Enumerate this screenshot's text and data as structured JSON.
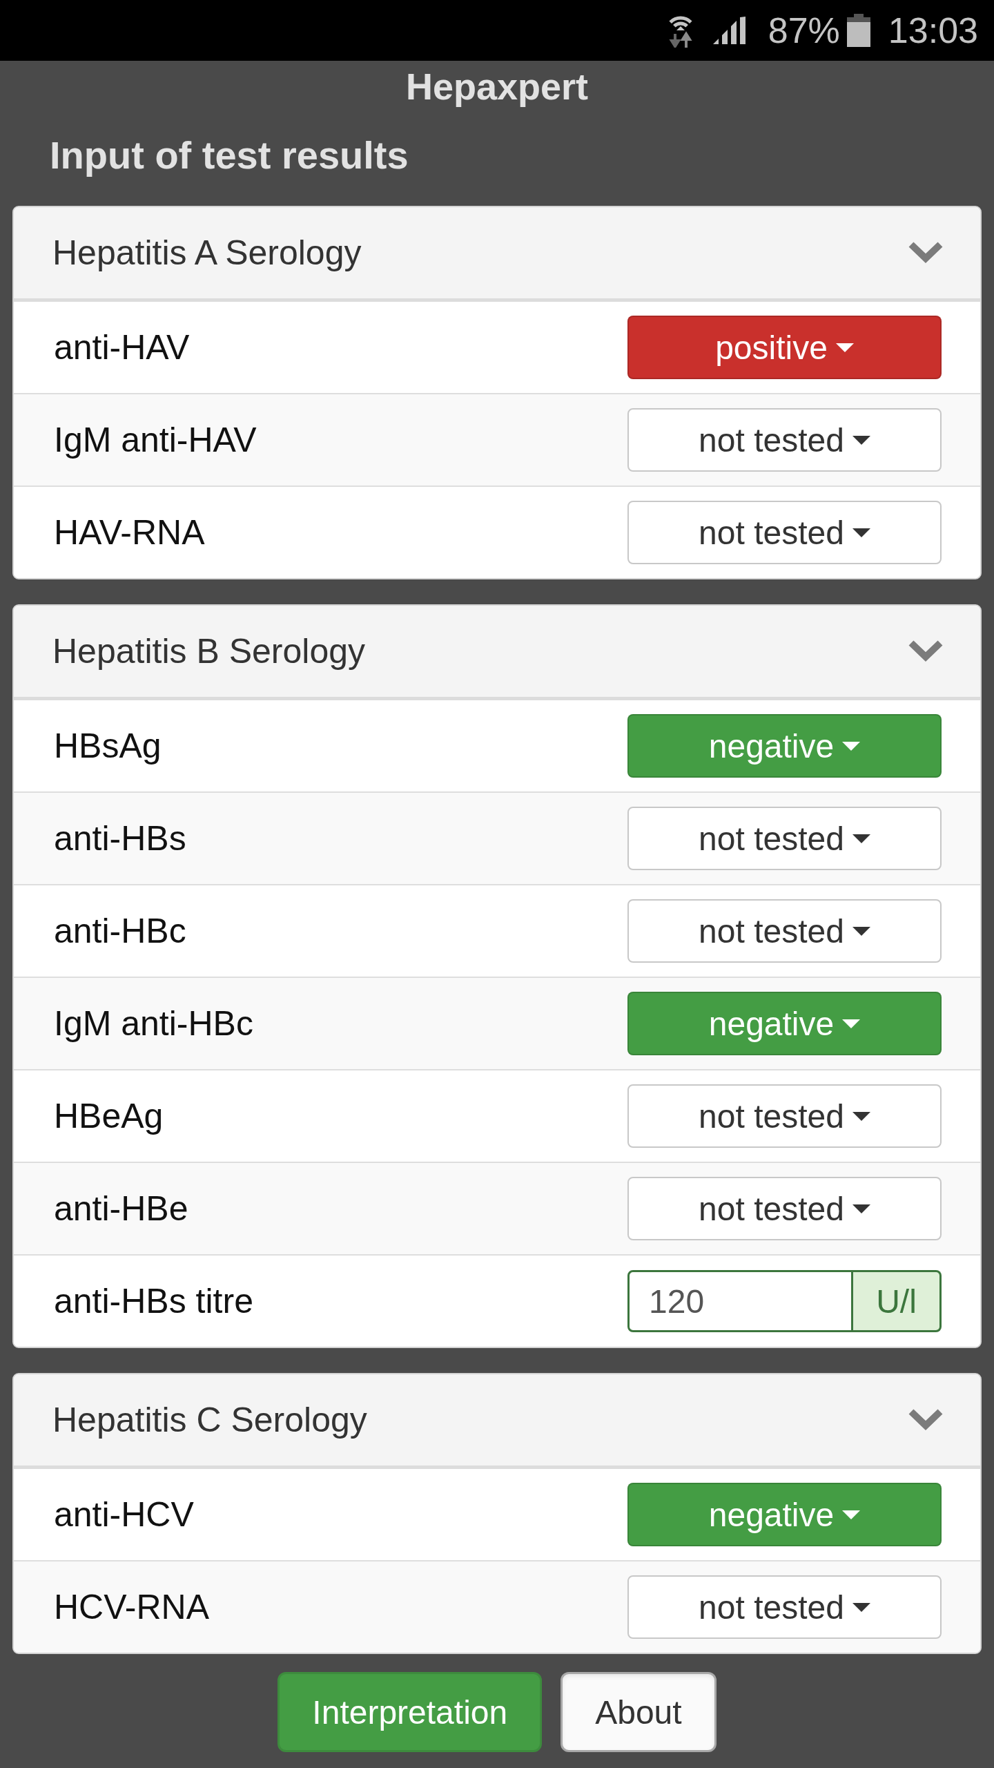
{
  "status_bar": {
    "battery": "87%",
    "time": "13:03"
  },
  "app_title": "Hepaxpert",
  "heading": "Input of test results",
  "panels": [
    {
      "title": "Hepatitis A Serology",
      "expanded": true,
      "rows": [
        {
          "kind": "select",
          "label": "anti-HAV",
          "value": "positive",
          "color": "#c9302c"
        },
        {
          "kind": "select",
          "label": "IgM anti-HAV",
          "value": "not tested"
        },
        {
          "kind": "select",
          "label": "HAV-RNA",
          "value": "not tested"
        }
      ]
    },
    {
      "title": "Hepatitis B Serology",
      "expanded": true,
      "rows": [
        {
          "kind": "select",
          "label": "HBsAg",
          "value": "negative",
          "color": "#449d44"
        },
        {
          "kind": "select",
          "label": "anti-HBs",
          "value": "not tested"
        },
        {
          "kind": "select",
          "label": "anti-HBc",
          "value": "not tested"
        },
        {
          "kind": "select",
          "label": "IgM anti-HBc",
          "value": "negative",
          "color": "#449d44"
        },
        {
          "kind": "select",
          "label": "HBeAg",
          "value": "not tested"
        },
        {
          "kind": "select",
          "label": "anti-HBe",
          "value": "not tested"
        },
        {
          "kind": "input",
          "label": "anti-HBs titre",
          "value": "120",
          "unit": "U/l",
          "valid": true
        }
      ]
    },
    {
      "title": "Hepatitis C Serology",
      "expanded": true,
      "rows": [
        {
          "kind": "select",
          "label": "anti-HCV",
          "value": "negative",
          "color": "#449d44"
        },
        {
          "kind": "select",
          "label": "HCV-RNA",
          "value": "not tested"
        }
      ]
    }
  ],
  "buttons": [
    {
      "label": "Interpretation",
      "kind": "primary"
    },
    {
      "label": "About",
      "kind": "default"
    }
  ]
}
